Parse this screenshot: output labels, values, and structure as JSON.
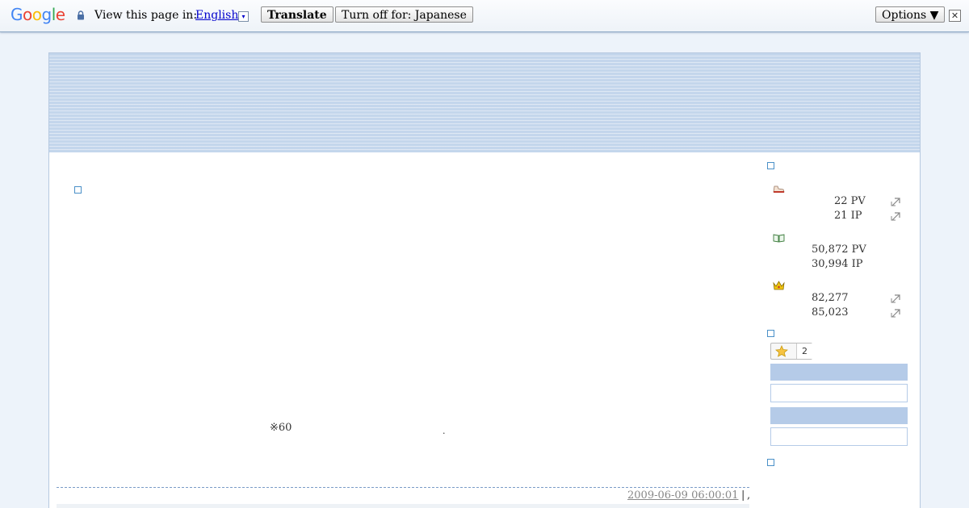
{
  "translate_bar": {
    "view_label": "View this page in:",
    "language": "English",
    "dropdown_glyph": "▾",
    "translate_button": "Translate",
    "turn_off_button": "Turn off for: Japanese",
    "options_button": "Options ▼",
    "close_glyph": "✕"
  },
  "entry": {
    "text": "※60",
    "mark": ".",
    "date": "2009-06-09 06:00:01",
    "separator": "|",
    "trail": ","
  },
  "sidebar": {
    "today": {
      "icon": "shoe-icon",
      "pv": "22 PV",
      "ip": "21 IP"
    },
    "total": {
      "icon": "book-icon",
      "pv": "50,872 PV",
      "ip": "30,994 IP"
    },
    "ranking": {
      "icon": "crown-icon",
      "rank1": "82,277",
      "rank2": "85,023"
    },
    "star_count": "2"
  },
  "colors": {
    "banner": "#c4d6ec",
    "page_bg": "#edf3fa",
    "sidebar_bar": "#b5cbe8",
    "square_icon": "#4a90c8"
  }
}
